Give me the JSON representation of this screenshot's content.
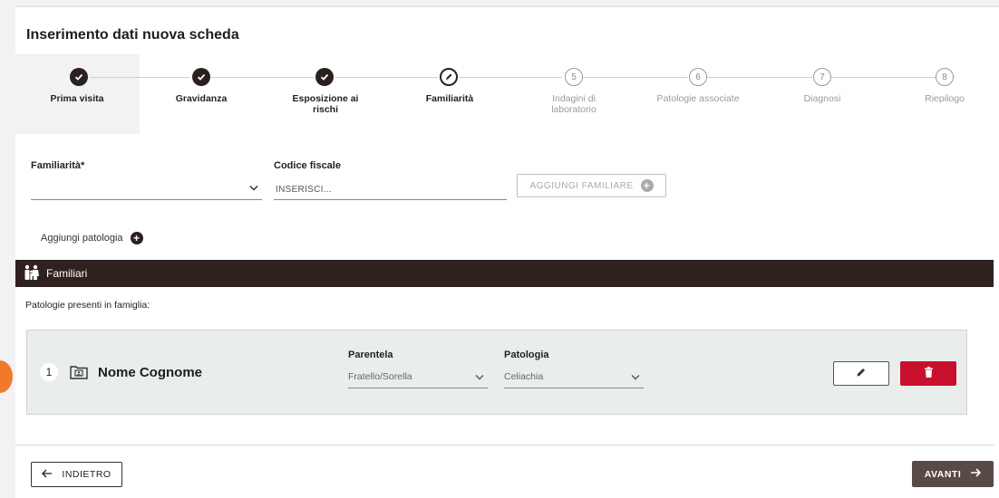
{
  "title": "Inserimento dati nuova scheda",
  "steps": [
    {
      "label": "Prima visita",
      "state": "done",
      "num": ""
    },
    {
      "label": "Gravidanza",
      "state": "done",
      "num": ""
    },
    {
      "label": "Esposizione ai rischi",
      "state": "done",
      "num": ""
    },
    {
      "label": "Familiarità",
      "state": "current",
      "num": ""
    },
    {
      "label": "Indagini di laboratorio",
      "state": "todo",
      "num": "5"
    },
    {
      "label": "Patologie associate",
      "state": "todo",
      "num": "6"
    },
    {
      "label": "Diagnosi",
      "state": "todo",
      "num": "7"
    },
    {
      "label": "Riepilogo",
      "state": "todo",
      "num": "8"
    }
  ],
  "form": {
    "familiarita_label": "Familiarità*",
    "familiarita_value": "",
    "codice_fiscale_label": "Codice fiscale",
    "codice_fiscale_placeholder": "INSERISCI...",
    "add_family_label": "AGGIUNGI FAMILIARE",
    "add_pathology_label": "Aggiungi patologia"
  },
  "section": {
    "title": "Familiari",
    "subtitle": "Patologie presenti in famiglia:"
  },
  "family_members": [
    {
      "index": "1",
      "name": "Nome Cognome",
      "parentela_label": "Parentela",
      "parentela_value": "Fratello/Sorella",
      "patologia_label": "Patologia",
      "patologia_value": "Celiachia"
    }
  ],
  "footer": {
    "back_label": "INDIETRO",
    "next_label": "AVANTI"
  },
  "colors": {
    "dark": "#2e211e",
    "danger": "#c8102e",
    "primary_btn": "#5a4a45",
    "row_bg": "#e9eeed"
  }
}
